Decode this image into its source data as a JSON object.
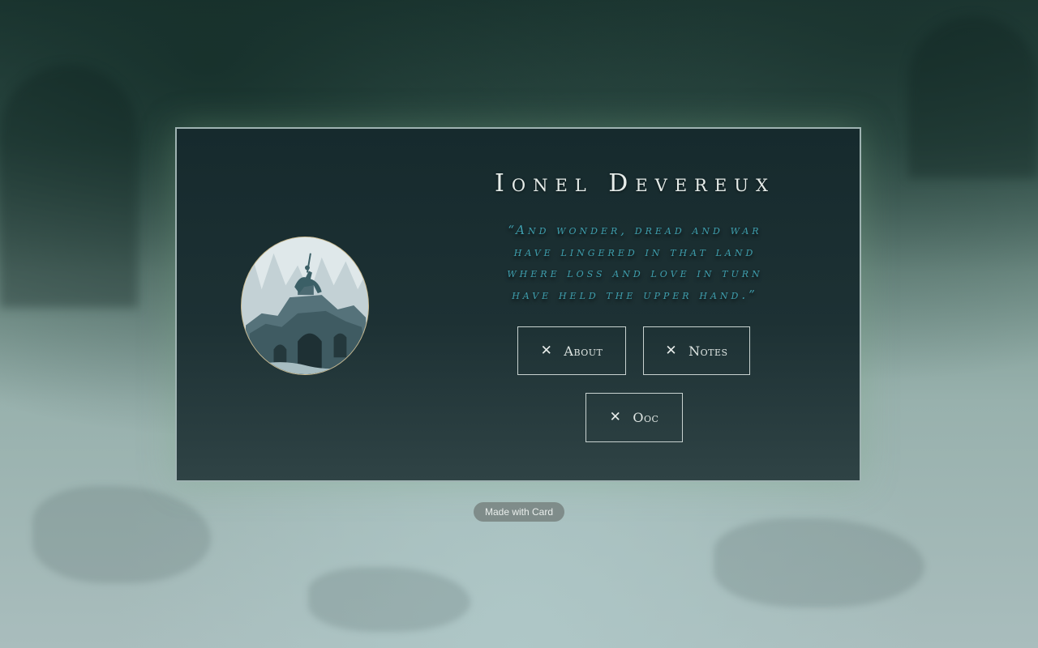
{
  "profile": {
    "name": "Ionel Devereux",
    "quote_lines": [
      "“And wonder, dread and war",
      "have lingered in that land",
      "where loss and love in turn",
      "have held the upper hand.”"
    ]
  },
  "buttons": {
    "about": {
      "label": "About",
      "icon": "close-icon"
    },
    "notes": {
      "label": "Notes",
      "icon": "close-icon"
    },
    "ooc": {
      "label": "Ooc",
      "icon": "close-icon"
    }
  },
  "footer": {
    "badge": "Made with Card"
  },
  "colors": {
    "quote": "#3f9fae",
    "title": "#e6ece9",
    "portrait_border": "#c9b98f",
    "card_border": "#9fb3b2"
  }
}
